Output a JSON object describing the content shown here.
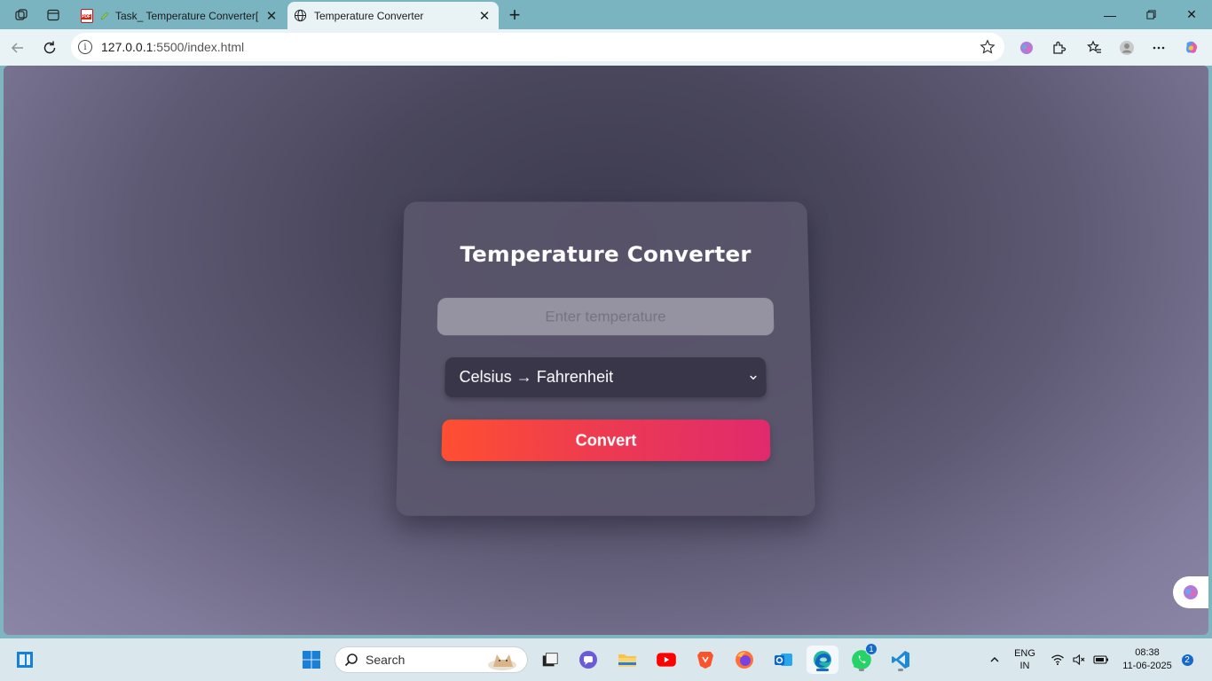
{
  "browser": {
    "tabs": [
      {
        "title": "Task_ Temperature Converter[",
        "favicon": "pdf-icon"
      },
      {
        "title": "Temperature Converter",
        "favicon": "globe-icon",
        "active": true
      }
    ],
    "url_host": "127.0.0.1",
    "url_rest": ":5500/index.html"
  },
  "page": {
    "title": "Temperature Converter",
    "input_placeholder": "Enter temperature",
    "select_value": "Celsius → Fahrenheit",
    "convert_label": "Convert"
  },
  "taskbar": {
    "search_label": "Search",
    "lang_line1": "ENG",
    "lang_line2": "IN",
    "time": "08:38",
    "date": "11-06-2025",
    "notification_count": "2",
    "whatsapp_badge": "1"
  },
  "colors": {
    "accent_start": "#ff4f31",
    "accent_end": "#e02a6d",
    "card_bg": "#5a566c",
    "page_bg_center": "#3c3a4e"
  }
}
